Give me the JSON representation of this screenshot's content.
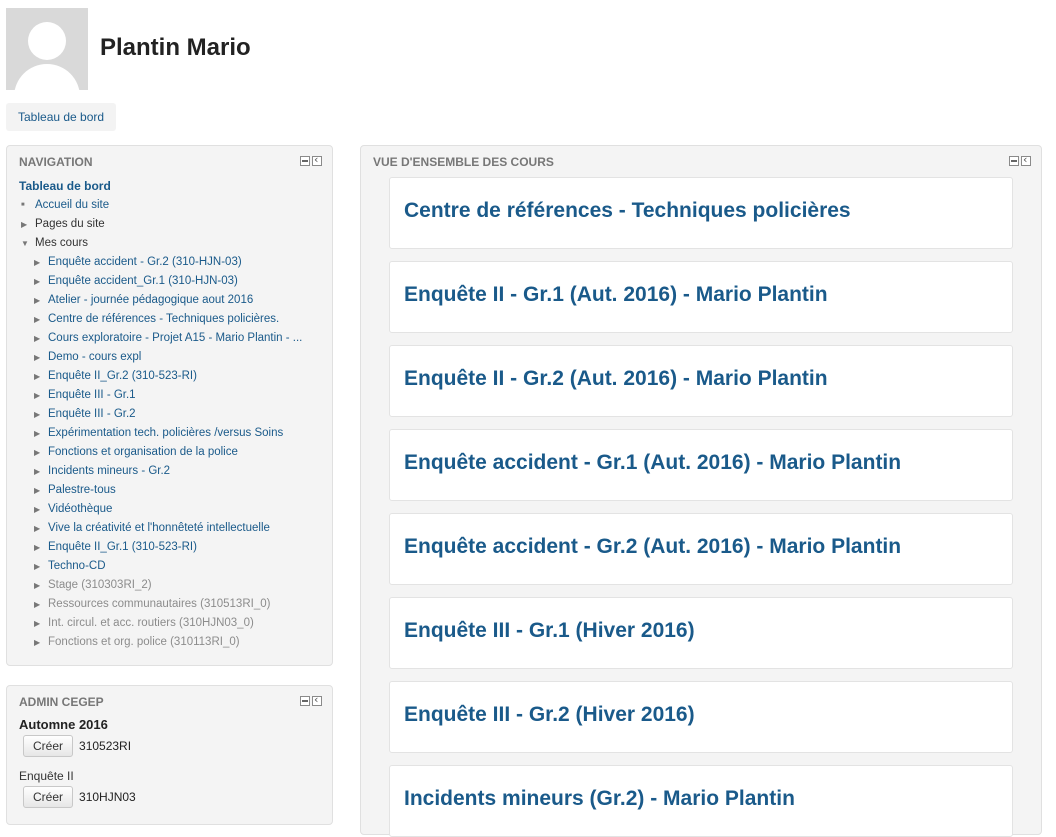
{
  "header": {
    "user_name": "Plantin Mario",
    "breadcrumb": "Tableau de bord"
  },
  "navigation": {
    "title": "NAVIGATION",
    "root": "Tableau de bord",
    "items": [
      {
        "label": "Accueil du site",
        "marker": "square",
        "style": "link",
        "level": 1
      },
      {
        "label": "Pages du site",
        "marker": "arrow-right",
        "style": "plain",
        "level": 1
      },
      {
        "label": "Mes cours",
        "marker": "arrow-down",
        "style": "plain",
        "level": 1
      },
      {
        "label": "Enquête accident - Gr.2 (310-HJN-03)",
        "marker": "arrow-right",
        "style": "link",
        "level": 2
      },
      {
        "label": "Enquête accident_Gr.1 (310-HJN-03)",
        "marker": "arrow-right",
        "style": "link",
        "level": 2
      },
      {
        "label": "Atelier - journée pédagogique aout 2016",
        "marker": "arrow-right",
        "style": "link",
        "level": 2
      },
      {
        "label": "Centre de références - Techniques policières.",
        "marker": "arrow-right",
        "style": "link",
        "level": 2
      },
      {
        "label": "Cours exploratoire - Projet A15 - Mario Plantin - ...",
        "marker": "arrow-right",
        "style": "link",
        "level": 2
      },
      {
        "label": "Demo - cours expl",
        "marker": "arrow-right",
        "style": "link",
        "level": 2
      },
      {
        "label": "Enquête II_Gr.2 (310-523-RI)",
        "marker": "arrow-right",
        "style": "link",
        "level": 2
      },
      {
        "label": "Enquête III - Gr.1",
        "marker": "arrow-right",
        "style": "link",
        "level": 2
      },
      {
        "label": "Enquête III - Gr.2",
        "marker": "arrow-right",
        "style": "link",
        "level": 2
      },
      {
        "label": "Expérimentation tech. policières /versus Soins",
        "marker": "arrow-right",
        "style": "link",
        "level": 2
      },
      {
        "label": "Fonctions et organisation de la police",
        "marker": "arrow-right",
        "style": "link",
        "level": 2
      },
      {
        "label": "Incidents mineurs - Gr.2",
        "marker": "arrow-right",
        "style": "link",
        "level": 2
      },
      {
        "label": "Palestre-tous",
        "marker": "arrow-right",
        "style": "link",
        "level": 2
      },
      {
        "label": "Vidéothèque",
        "marker": "arrow-right",
        "style": "link",
        "level": 2
      },
      {
        "label": "Vive la créativité et l'honnêteté intellectuelle",
        "marker": "arrow-right",
        "style": "link",
        "level": 2
      },
      {
        "label": "Enquête II_Gr.1 (310-523-RI)",
        "marker": "arrow-right",
        "style": "link",
        "level": 2
      },
      {
        "label": "Techno-CD",
        "marker": "arrow-right",
        "style": "link",
        "level": 2
      },
      {
        "label": "Stage (310303RI_2)",
        "marker": "arrow-right",
        "style": "dim",
        "level": 2
      },
      {
        "label": "Ressources communautaires (310513RI_0)",
        "marker": "arrow-right",
        "style": "dim",
        "level": 2
      },
      {
        "label": "Int. circul. et acc. routiers (310HJN03_0)",
        "marker": "arrow-right",
        "style": "dim",
        "level": 2
      },
      {
        "label": "Fonctions et org. police (310113RI_0)",
        "marker": "arrow-right",
        "style": "dim",
        "level": 2
      }
    ]
  },
  "admin": {
    "title": "ADMIN CEGEP",
    "subtitle1": "Automne 2016",
    "create_button": "Créer",
    "code1": "310523RI",
    "subtitle2": "Enquête II",
    "code2": "310HJN03"
  },
  "courses": {
    "title": "VUE D'ENSEMBLE DES COURS",
    "items": [
      "Centre de références - Techniques policières",
      "Enquête II - Gr.1 (Aut. 2016) - Mario Plantin",
      "Enquête II - Gr.2 (Aut. 2016) - Mario Plantin",
      "Enquête accident - Gr.1 (Aut. 2016) - Mario Plantin",
      "Enquête accident - Gr.2 (Aut. 2016) - Mario Plantin",
      "Enquête III - Gr.1 (Hiver 2016)",
      "Enquête III - Gr.2 (Hiver 2016)",
      "Incidents mineurs (Gr.2) - Mario Plantin"
    ]
  },
  "icons": {
    "collapse": "collapse-block-icon",
    "dock": "dock-block-icon",
    "avatar": "default-user-avatar"
  },
  "colors": {
    "link": "#1a5a8a",
    "block_background": "#f4f4f4",
    "muted_text": "#8c8c8c"
  }
}
